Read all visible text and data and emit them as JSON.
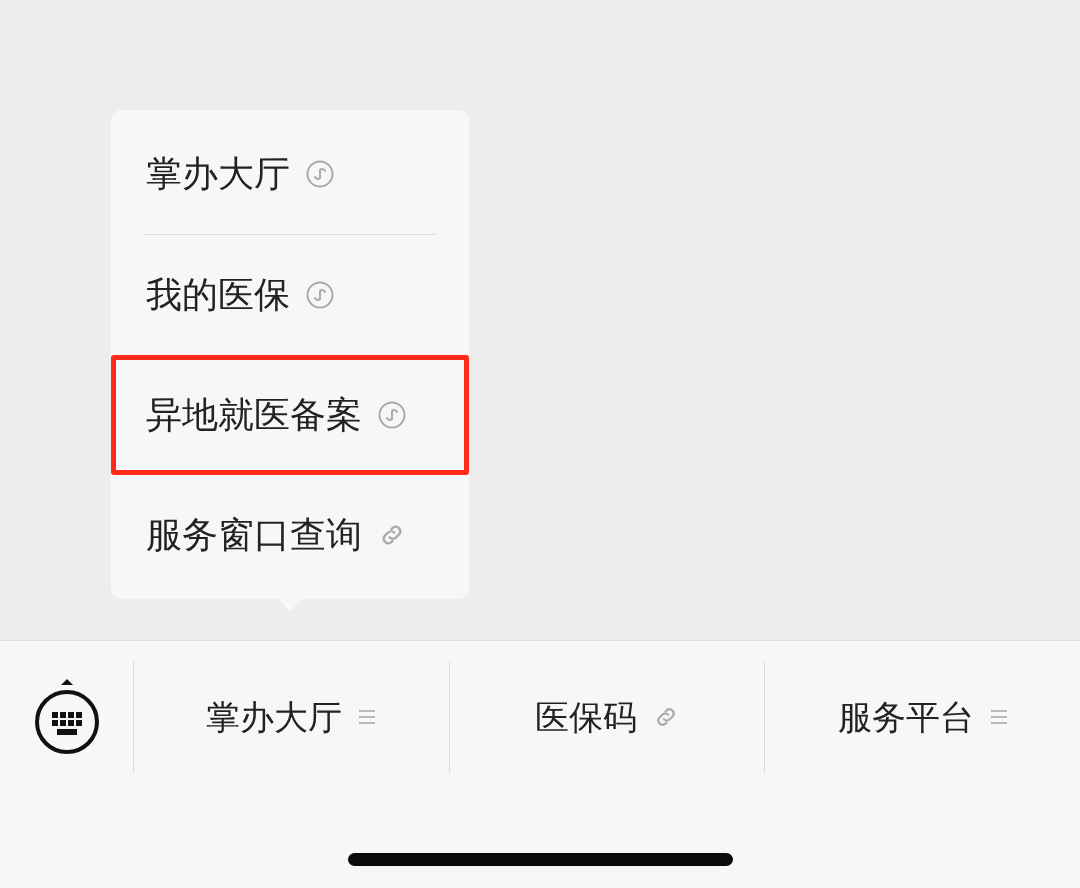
{
  "popup_menu": {
    "items": [
      {
        "label": "掌办大厅",
        "kind": "miniprogram",
        "highlighted": false
      },
      {
        "label": "我的医保",
        "kind": "miniprogram",
        "highlighted": false
      },
      {
        "label": "异地就医备案",
        "kind": "miniprogram",
        "highlighted": true
      },
      {
        "label": "服务窗口查询",
        "kind": "link",
        "highlighted": false
      }
    ]
  },
  "bottom_menu": {
    "items": [
      {
        "label": "掌办大厅",
        "kind": "submenu"
      },
      {
        "label": "医保码",
        "kind": "link"
      },
      {
        "label": "服务平台",
        "kind": "submenu"
      }
    ]
  }
}
